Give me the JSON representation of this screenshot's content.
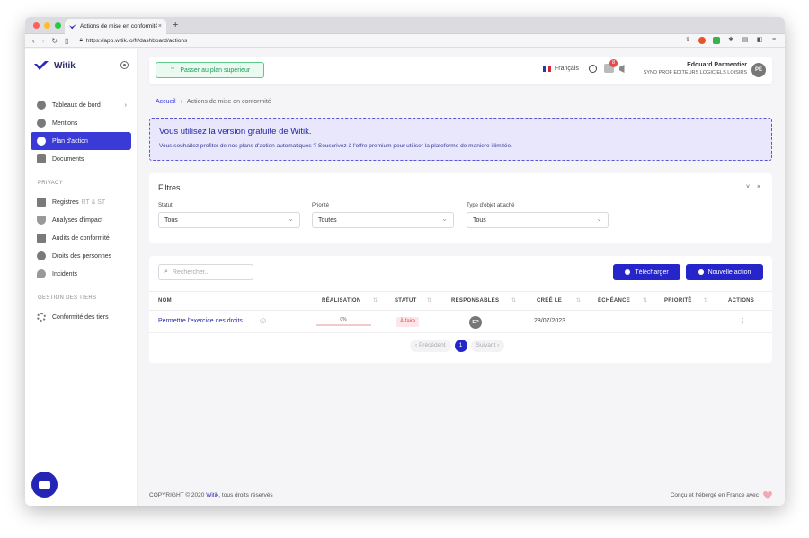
{
  "browser": {
    "tab_title": "Actions de mise en conformité",
    "url": "https://app.witik.io/fr/dashboard/actions",
    "new_tab": "+",
    "close": "×"
  },
  "sidebar": {
    "brand": "Witik",
    "main_items": [
      {
        "label": "Tableaux de bord",
        "icon": "dashboard-icon",
        "chevron": "›"
      },
      {
        "label": "Mentions",
        "icon": "mentions-icon"
      },
      {
        "label": "Plan d'action",
        "icon": "action-plan-icon",
        "active": true
      },
      {
        "label": "Documents",
        "icon": "folder-icon"
      }
    ],
    "privacy_title": "PRIVACY",
    "privacy_items": [
      {
        "label": "Registres",
        "suffix": "RT & ST",
        "icon": "registers-icon"
      },
      {
        "label": "Analyses d'impact",
        "icon": "shield-icon"
      },
      {
        "label": "Audits de conformité",
        "icon": "audit-icon"
      },
      {
        "label": "Droits des personnes",
        "icon": "people-icon"
      },
      {
        "label": "Incidents",
        "icon": "fire-icon"
      }
    ],
    "third_title": "GESTION DES TIERS",
    "third_items": [
      {
        "label": "Conformité des tiers",
        "icon": "network-icon"
      }
    ]
  },
  "topbar": {
    "upgrade": "Passer au plan supérieur",
    "language": "Français",
    "notifications": "8",
    "user_name": "Edouard Parmentier",
    "user_org": "SYND PROF EDITEURS LOGICIELS LOISIRS",
    "user_initials": "PE"
  },
  "breadcrumb": {
    "home": "Accueil",
    "sep": "›",
    "current": "Actions de mise en conformité"
  },
  "promo": {
    "title": "Vous utilisez la version gratuite de Witik.",
    "text": "Vous souhaitez profiter de nos plans d'action automatiques ? Souscrivez à l'offre premium pour utiliser la plateforme de maniere illimitée."
  },
  "filters": {
    "title": "Filtres",
    "collapse": "˅",
    "close": "×",
    "statut_label": "Statut",
    "statut_value": "Tous",
    "priorite_label": "Priorité",
    "priorite_value": "Toutes",
    "type_label": "Type d'objet attaché",
    "type_value": "Tous"
  },
  "table": {
    "search_placeholder": "Rechercher...",
    "download": "Télécharger",
    "new_action": "Nouvelle action",
    "columns": [
      "NOM",
      "RÉALISATION",
      "STATUT",
      "RESPONSABLES",
      "CRÉÉ LE",
      "ÉCHÉANCE",
      "PRIORITÉ",
      "ACTIONS"
    ],
    "rows": [
      {
        "name": "Permettre l'exercice des droits.",
        "progress": 0,
        "progress_label": "0%",
        "status": "À faire",
        "responsible": "EP",
        "created": "28/07/2023",
        "due": "",
        "priority": ""
      }
    ],
    "pagination": {
      "prev": "‹ Précédent",
      "page": "1",
      "next": "Suivant ›"
    }
  },
  "footer": {
    "copyright_prefix": "COPYRIGHT © 2020 ",
    "brand": "Witik",
    "copyright_suffix": ", tous droits réservés",
    "right": "Conçu et hébergé en France avec"
  },
  "colors": {
    "accent": "#2525c9",
    "active_menu": "#3a3ad6",
    "status_todo": "#d8444e",
    "upgrade_green": "#1b9c57"
  }
}
